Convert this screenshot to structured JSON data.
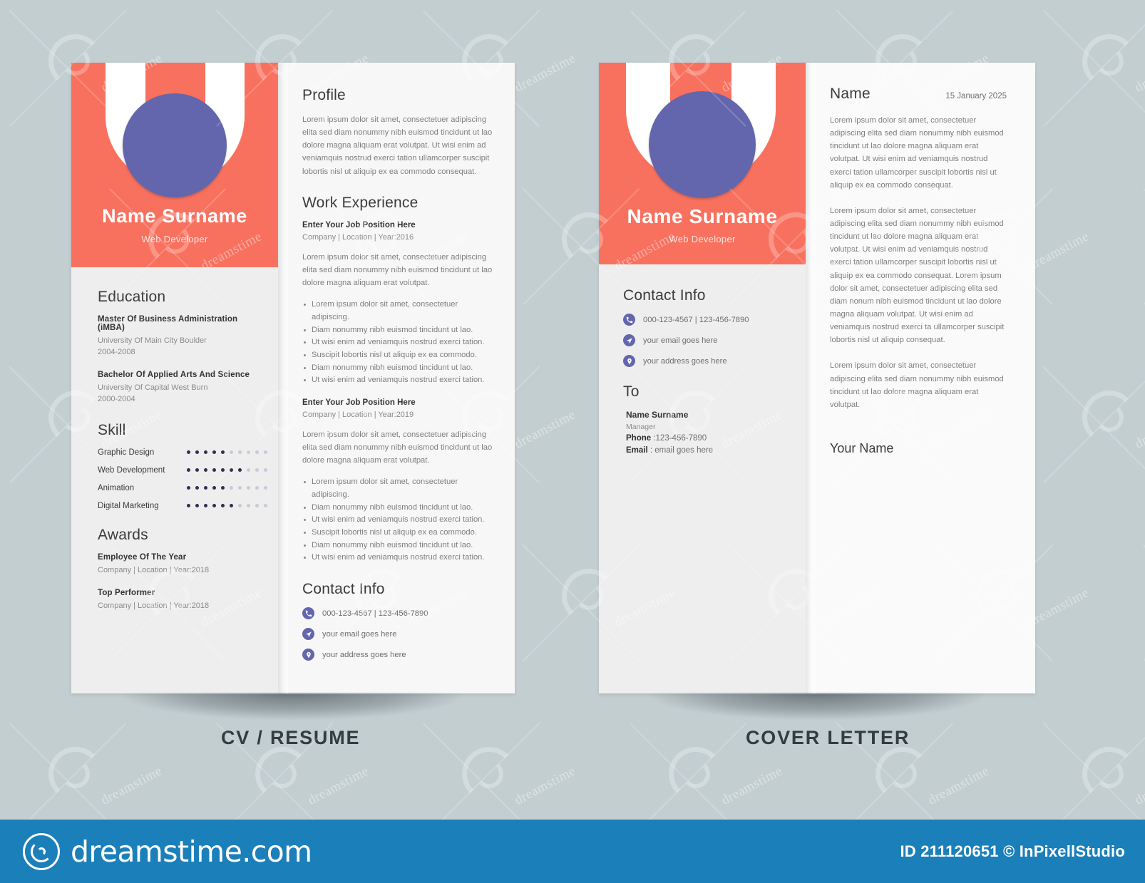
{
  "page": {
    "background_color": "#c3ced1",
    "captions": {
      "cv": "CV / RESUME",
      "cover_letter": "COVER LETTER"
    }
  },
  "colors": {
    "accent_coral": "#f8715f",
    "avatar_purple": "#6366ad",
    "panel_gray": "#eeeeee",
    "footer_blue": "#1b7fba",
    "heading_dark": "#3c3c3c",
    "body_gray": "#7f7f7f"
  },
  "cv": {
    "header": {
      "name": "Name Surname",
      "role": "Web Developer",
      "avatar_icon": "avatar-circle"
    },
    "education": {
      "heading": "Education",
      "entries": [
        {
          "title": "Master Of Business Administration (iMBA)",
          "school": "University Of Main City Boulder",
          "years": "2004-2008"
        },
        {
          "title": "Bachelor Of Applied Arts And Science",
          "school": "University Of Capital West Burn",
          "years": "2000-2004"
        }
      ]
    },
    "skill": {
      "heading": "Skill",
      "total_dots": 10,
      "items": [
        {
          "name": "Graphic Design",
          "filled": 5
        },
        {
          "name": "Web Development",
          "filled": 7
        },
        {
          "name": "Animation",
          "filled": 5
        },
        {
          "name": "Digital Marketing",
          "filled": 6
        }
      ]
    },
    "awards": {
      "heading": "Awards",
      "entries": [
        {
          "title": "Employee Of The Year",
          "meta": "Company | Location | Year:2018"
        },
        {
          "title": "Top Performer",
          "meta": "Company | Location | Year:2018"
        }
      ]
    },
    "profile": {
      "heading": "Profile",
      "text": "Lorem ipsum dolor sit amet, consectetuer adipiscing elita sed diam nonummy nibh euismod tincidunt ut lao dolore magna aliquam erat volutpat. Ut wisi enim ad veniamquis nostrud exerci tation ullamcorper suscipit lobortis nisl ut aliquip ex ea commodo consequat."
    },
    "work_experience": {
      "heading": "Work Experience",
      "jobs": [
        {
          "title": "Enter Your Job Position Here",
          "meta": "Company | Location | Year:2016",
          "summary": "Lorem ipsum dolor sit amet, consectetuer adipiscing elita sed diam nonummy nibh euismod tincidunt ut lao dolore magna aliquam erat volutpat.",
          "bullets": [
            "Lorem ipsum dolor sit amet, consectetuer adipiscing.",
            "Diam nonummy nibh euismod tincidunt ut lao.",
            "Ut wisi enim ad veniamquis nostrud exerci tation.",
            "Suscipit lobortis nisl ut aliquip ex ea commodo.",
            "Diam nonummy nibh euismod tincidunt ut lao.",
            "Ut wisi enim ad veniamquis nostrud exerci tation."
          ]
        },
        {
          "title": "Enter Your Job Position Here",
          "meta": "Company | Location | Year:2019",
          "summary": "Lorem ipsum dolor sit amet, consectetuer adipiscing elita sed diam nonummy nibh euismod tincidunt ut lao dolore magna aliquam erat volutpat.",
          "bullets": [
            "Lorem ipsum dolor sit amet, consectetuer adipiscing.",
            "Diam nonummy nibh euismod tincidunt ut lao.",
            "Ut wisi enim ad veniamquis nostrud exerci tation.",
            "Suscipit lobortis nisl ut aliquip ex ea commodo.",
            "Diam nonummy nibh euismod tincidunt ut lao.",
            "Ut wisi enim ad veniamquis nostrud exerci tation."
          ]
        }
      ]
    },
    "contact_info": {
      "heading": "Contact Info",
      "rows": [
        {
          "icon": "phone-icon",
          "text": "000-123-4567 |  123-456-7890"
        },
        {
          "icon": "send-icon",
          "text": "your email goes here"
        },
        {
          "icon": "location-pin-icon",
          "text": "your address goes here"
        }
      ]
    }
  },
  "cover_letter": {
    "header": {
      "name": "Name Surname",
      "role": "Web Developer",
      "avatar_icon": "avatar-circle"
    },
    "contact_info": {
      "heading": "Contact Info",
      "rows": [
        {
          "icon": "phone-icon",
          "text": "000-123-4567 |  123-456-7890"
        },
        {
          "icon": "send-icon",
          "text": "your email goes here"
        },
        {
          "icon": "location-pin-icon",
          "text": "your address goes here"
        }
      ]
    },
    "to": {
      "heading": "To",
      "name": "Name Surname",
      "role": "Manager",
      "phone_label": "Phone",
      "phone_value": ":123-456-7890",
      "email_label": "Email",
      "email_value": ": email goes here"
    },
    "body": {
      "title": "Name",
      "date": "15 January 2025",
      "paragraphs": [
        "Lorem ipsum dolor sit amet, consectetuer adipiscing elita sed diam nonummy nibh euismod tincidunt ut lao dolore magna aliquam erat volutpat. Ut wisi enim ad veniamquis nostrud exerci tation ullamcorper suscipit lobortis nisl ut aliquip ex ea commodo consequat.",
        "Lorem ipsum dolor sit amet, consectetuer adipiscing elita sed diam nonummy nibh euismod tincidunt ut lao dolore magna aliquam erat volutpat. Ut wisi enim ad veniamquis nostrud exerci tation ullamcorper suscipit lobortis nisl ut aliquip ex ea commodo consequat. Lorem ipsum dolor sit amet, consectetuer adipiscing elita sed diam nonum nibh euismod tincidunt ut lao dolore magna aliquam  volutpat. Ut wisi enim ad veniamquis nostrud exerci ta ullamcorper suscipit lobortis nisl ut aliquip consequat.",
        "Lorem ipsum dolor sit amet, consectetuer adipiscing elita sed diam nonummy nibh euismod tincidunt ut lao dolore magna aliquam erat volutpat."
      ],
      "signature": "Your Name"
    }
  },
  "footer": {
    "brand_name": "dreamstime.com",
    "brand_icon": "spiral-logo-icon",
    "id_text": "ID 211120651 © InPixellStudio"
  },
  "watermark": {
    "text": "dreamstime"
  }
}
